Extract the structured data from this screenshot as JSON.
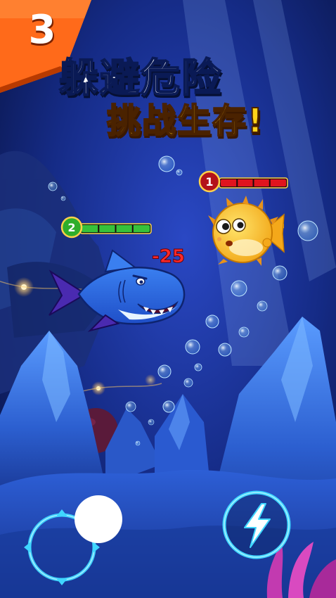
{
  "level_badge": {
    "number": "3",
    "color": "#ff6a1a"
  },
  "headline": {
    "line1": "躲避危险",
    "line2": "挑战生存!"
  },
  "player": {
    "name": "shark",
    "level": "2",
    "health_fraction": 1.0,
    "badge_color": "#2fae2b",
    "bar_color": "#36c23a",
    "damage_text": "-25"
  },
  "enemy": {
    "name": "pufferfish",
    "level": "1",
    "health_fraction": 1.0,
    "badge_color": "#b3121a",
    "bar_color": "#e0141e"
  },
  "controls": {
    "joystick": "joystick",
    "boost_icon": "lightning-icon"
  },
  "colors": {
    "ocean_deep": "#0a1650",
    "ocean_mid": "#1a3aa8",
    "rock": "#2f66d8",
    "control_glow": "#3fd6ff"
  }
}
